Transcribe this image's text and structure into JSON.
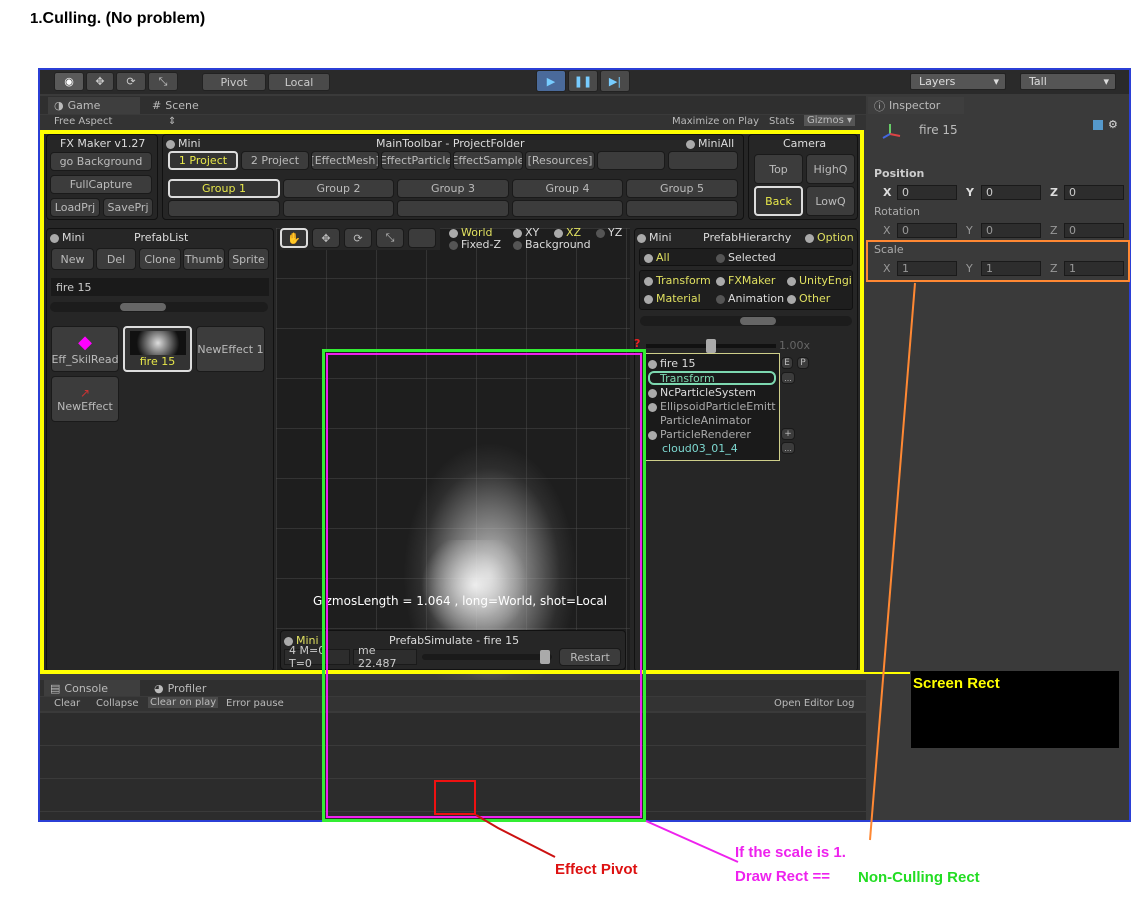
{
  "heading": {
    "num": "1.",
    "text": "Culling. (No problem)"
  },
  "toolbar": {
    "pivot": "Pivot",
    "local": "Local",
    "layers": "Layers",
    "layout": "Tall"
  },
  "tabs": {
    "game": "Game",
    "scene": "Scene",
    "inspector": "Inspector",
    "console": "Console",
    "profiler": "Profiler"
  },
  "game_bar": {
    "aspect": "Free Aspect",
    "maximize": "Maximize on Play",
    "stats": "Stats",
    "gizmos": "Gizmos"
  },
  "fxmaker": {
    "title": "FX Maker v1.27",
    "go_background": "go Background",
    "full_capture": "FullCapture",
    "load_prj": "LoadPrj",
    "save_prj": "SavePrj"
  },
  "main_toolbar": {
    "mini": "Mini",
    "title": "MainToolbar - ProjectFolder",
    "mini_all": "MiniAll",
    "folders": [
      "1 Project",
      "2 Project",
      "[EffectMesh]",
      "EffectParticle",
      "EffectSample",
      "[Resources]"
    ],
    "groups": [
      "Group 1",
      "Group 2",
      "Group 3",
      "Group 4",
      "Group 5"
    ]
  },
  "camera": {
    "title": "Camera",
    "top": "Top",
    "highq": "HighQ",
    "back": "Back",
    "lowq": "LowQ"
  },
  "prefab_list": {
    "mini": "Mini",
    "title": "PrefabList",
    "buttons": [
      "New",
      "Del",
      "Clone",
      "Thumb",
      "Sprite"
    ],
    "search": "fire 15",
    "items": [
      "Eff_SkilRead",
      "fire 15",
      "NewEffect 1",
      "NewEffect"
    ]
  },
  "scene_tools": {
    "world": "World",
    "fixed_z": "Fixed-Z",
    "xy": "XY",
    "xz": "XZ",
    "yz": "YZ",
    "background": "Background"
  },
  "hierarchy": {
    "mini": "Mini",
    "title": "PrefabHierarchy",
    "option": "Option",
    "all": "All",
    "selected": "Selected",
    "transform": "Transform",
    "fxmaker": "FXMaker",
    "unity": "UnityEngi",
    "material": "Material",
    "animation": "Animation",
    "other": "Other",
    "scale": "1.00x",
    "question": "?",
    "tree": [
      "fire 15",
      "Transform",
      "NcParticleSystem",
      "EllipsoidParticleEmitt",
      "ParticleAnimator",
      "ParticleRenderer",
      "cloud03_01_4"
    ],
    "e": "E",
    "p": "P"
  },
  "gizmos_text": "GizmosLength = 1.064 , long=World, shot=Local",
  "simulate": {
    "mini": "Mini",
    "title": "PrefabSimulate - fire 15",
    "stats": "4 M=0 T=0",
    "time": "me 22.487",
    "restart": "Restart"
  },
  "console": {
    "clear": "Clear",
    "collapse": "Collapse",
    "clear_on_play": "Clear on play",
    "error_pause": "Error pause",
    "open_log": "Open Editor Log"
  },
  "inspector": {
    "object": "fire 15",
    "position": "Position",
    "rotation": "Rotation",
    "scale": "Scale",
    "x": "X",
    "y": "Y",
    "z": "Z",
    "pos": [
      "0",
      "0",
      "0"
    ],
    "rot": [
      "0",
      "0",
      "0"
    ],
    "scl": [
      "1",
      "1",
      "1"
    ]
  },
  "annotations": {
    "screen_rect": "Screen Rect",
    "effect_pivot": "Effect Pivot",
    "scale_note": "If the scale is 1.",
    "draw_rect": "Draw Rect ==",
    "non_culling": "Non-Culling Rect"
  },
  "colors": {
    "screen_rect": "#ffff00",
    "non_culling": "#33ee33",
    "draw_rect": "#ee22ee",
    "pivot": "#ee1111",
    "scale": "#ff8833",
    "border": "#2b3fd6"
  }
}
